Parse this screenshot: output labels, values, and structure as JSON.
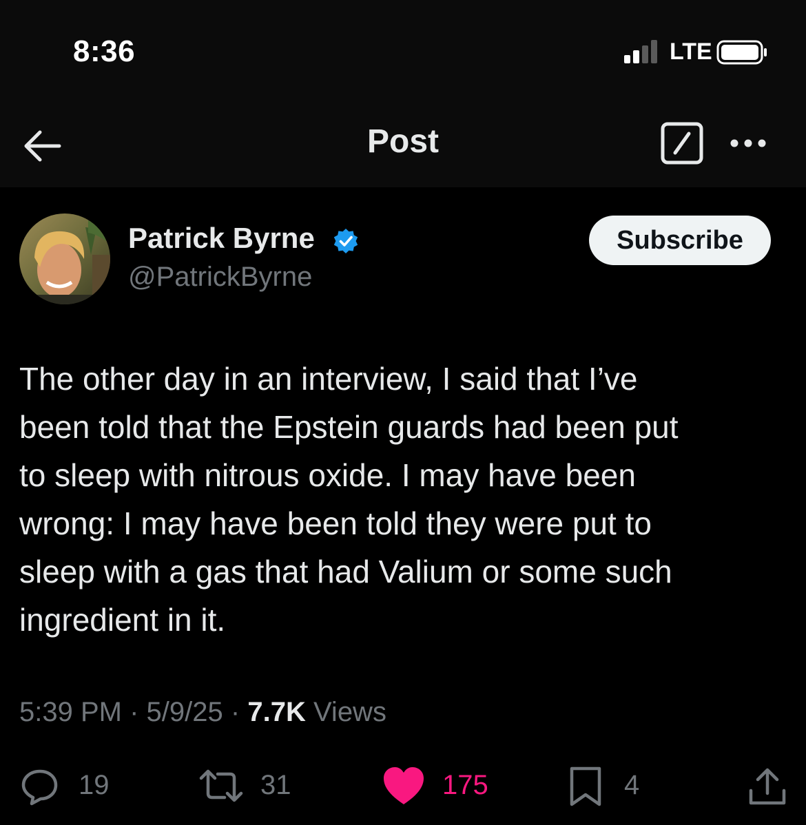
{
  "status_bar": {
    "time": "8:36",
    "network": "LTE",
    "icons": [
      "signal-bars-icon",
      "battery-icon"
    ]
  },
  "header": {
    "title": "Post",
    "back_icon": "back-arrow-icon",
    "grok_icon": "grok-slash-icon",
    "more_icon": "more-dots-icon"
  },
  "author": {
    "display_name": "Patrick Byrne",
    "handle": "@PatrickByrne",
    "verified_icon": "verified-badge-icon",
    "verified_color": "#1d9bf0",
    "subscribe_label": "Subscribe"
  },
  "tweet": {
    "lines": [
      "The other day in an interview, I said that I’ve",
      "been told that the Epstein guards had been put",
      "to sleep with nitrous oxide. I may have been",
      "wrong: I may have been told they were put to",
      "sleep with a gas that had Valium or some such",
      "ingredient in it."
    ],
    "time": "5:39 PM",
    "separator": "·",
    "date": "5/9/25",
    "views_count": "7.7K",
    "views_label": "Views"
  },
  "actions": {
    "replies": {
      "icon": "reply-bubble-icon",
      "count": "19"
    },
    "reposts": {
      "icon": "repost-arrows-icon",
      "count": "31"
    },
    "likes": {
      "icon": "heart-icon",
      "count": "175",
      "liked": true,
      "color": "#f91880"
    },
    "bookmarks": {
      "icon": "bookmark-icon",
      "count": "4"
    },
    "share": {
      "icon": "share-upload-icon"
    }
  }
}
